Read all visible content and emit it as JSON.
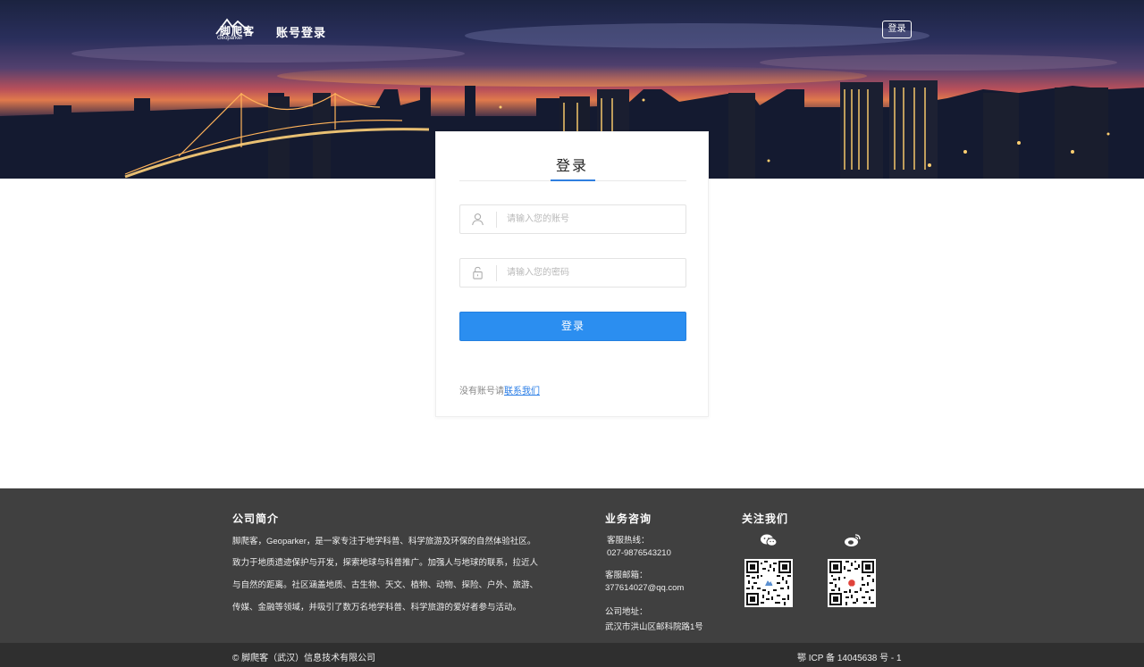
{
  "header": {
    "logo_text": "脚爬客",
    "logo_subtext": "Geoparker",
    "title": "账号登录",
    "login_label": "登录"
  },
  "login_card": {
    "title": "登录",
    "username_placeholder": "请输入您的账号",
    "password_placeholder": "请输入您的密码",
    "submit_label": "登录",
    "signup_prefix": "没有账号请",
    "signup_link": "联系我们"
  },
  "footer": {
    "about": {
      "heading": "公司简介",
      "lines": [
        "脚爬客，Geoparker，是一家专注于地学科普、科学旅游及环保的自然体验社区。",
        "致力于地质遗迹保护与开发，探索地球与科普推广。加强人与地球的联系，拉近人",
        "与自然的距离。社区涵盖地质、古生物、天文、植物、动物、探险、户外、旅游、",
        "传媒、金融等领域，并吸引了数万名地学科普、科学旅游的爱好者参与活动。"
      ]
    },
    "business": {
      "heading": "业务咨询",
      "hotline_label": "客服热线：",
      "hotline": "027-9876543210",
      "email_label": "客服邮箱：",
      "email": "377614027@qq.com",
      "address_label": "公司地址：",
      "address": "武汉市洪山区邮科院路1号"
    },
    "follow": {
      "heading": "关注我们",
      "wechat_icon": "wechat-icon",
      "weibo_icon": "weibo-icon"
    },
    "copyright": "© 脚爬客（武汉）信息技术有限公司",
    "icp": "鄂 ICP 备 14045638 号 - 1"
  },
  "colors": {
    "primary": "#2b8ef0",
    "link": "#2b7ee6",
    "footer_bg": "#404040",
    "copyright_bg": "#2f2f2f"
  }
}
